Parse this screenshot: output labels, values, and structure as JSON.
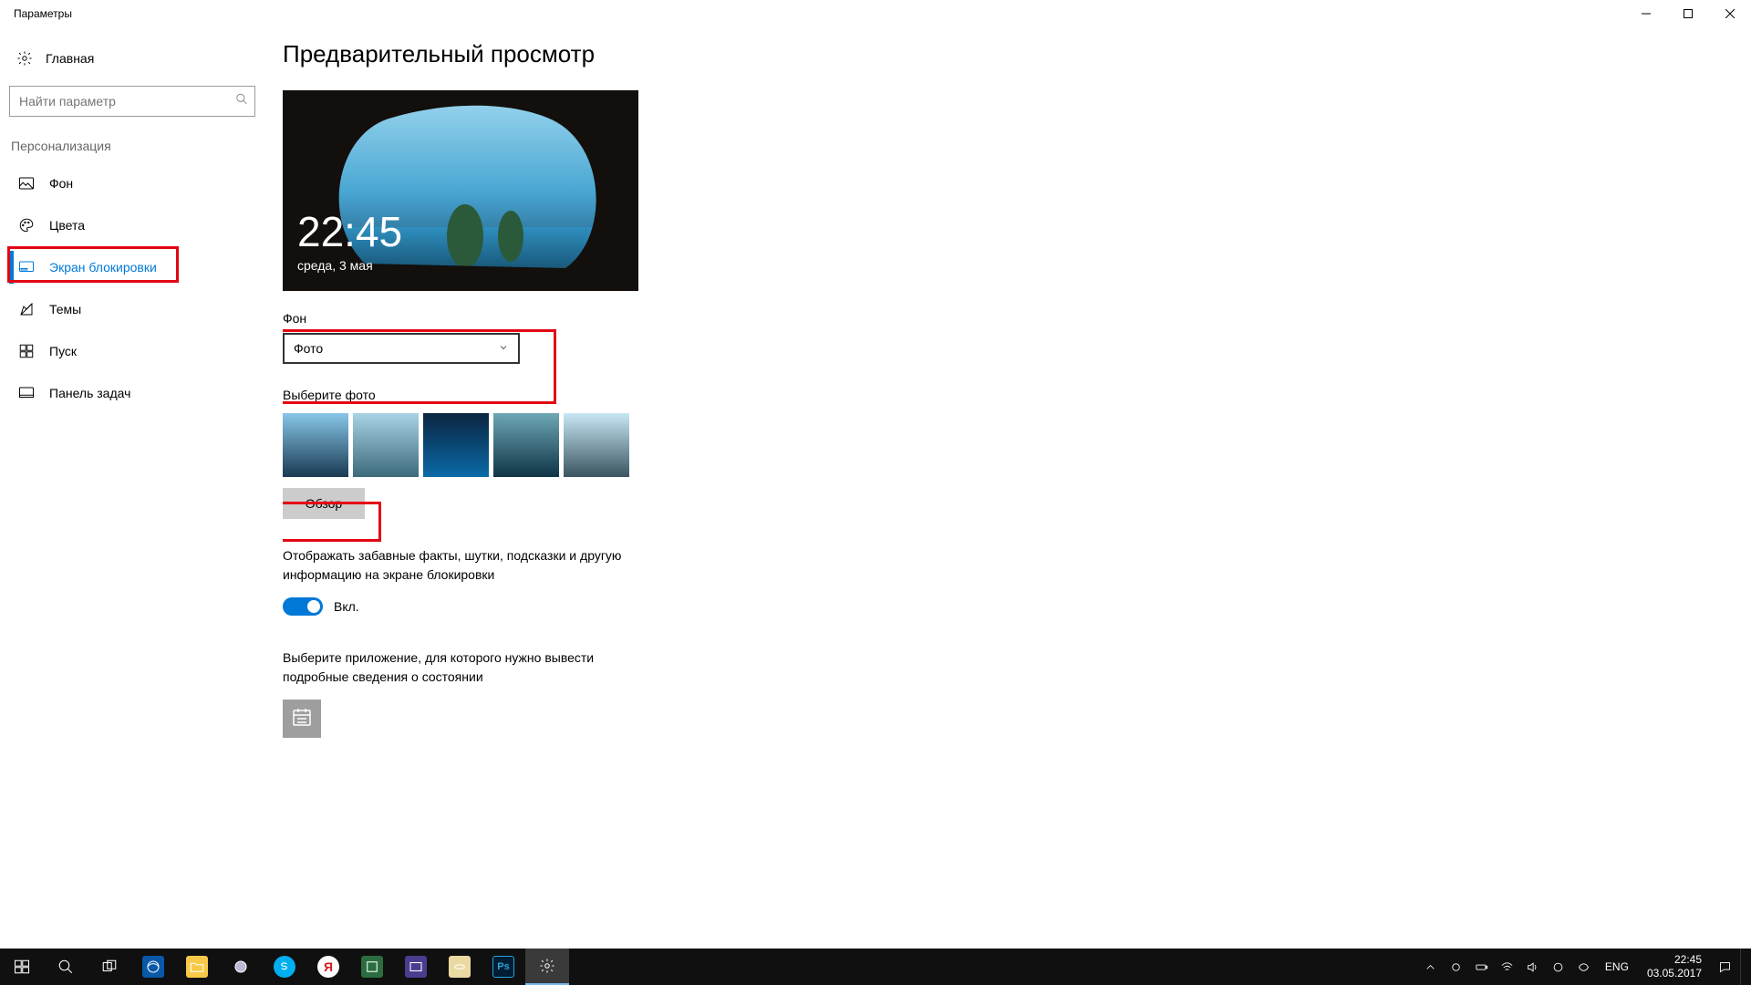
{
  "window": {
    "title": "Параметры"
  },
  "sidebar": {
    "home": "Главная",
    "search_placeholder": "Найти параметр",
    "group": "Персонализация",
    "items": [
      {
        "id": "background",
        "label": "Фон"
      },
      {
        "id": "colors",
        "label": "Цвета"
      },
      {
        "id": "lockscreen",
        "label": "Экран блокировки",
        "active": true
      },
      {
        "id": "themes",
        "label": "Темы"
      },
      {
        "id": "start",
        "label": "Пуск"
      },
      {
        "id": "taskbar",
        "label": "Панель задач"
      }
    ]
  },
  "content": {
    "title": "Предварительный просмотр",
    "preview": {
      "time": "22:45",
      "date": "среда, 3 мая"
    },
    "background_label": "Фон",
    "background_value": "Фото",
    "choose_photo_label": "Выберите фото",
    "browse_label": "Обзор",
    "facts_label": "Отображать забавные факты, шутки, подсказки и другую информацию на экране блокировки",
    "toggle_state": "Вкл.",
    "status_app_label": "Выберите приложение, для которого нужно вывести подробные сведения о состоянии"
  },
  "taskbar": {
    "lang": "ENG",
    "time": "22:45",
    "date": "03.05.2017"
  }
}
